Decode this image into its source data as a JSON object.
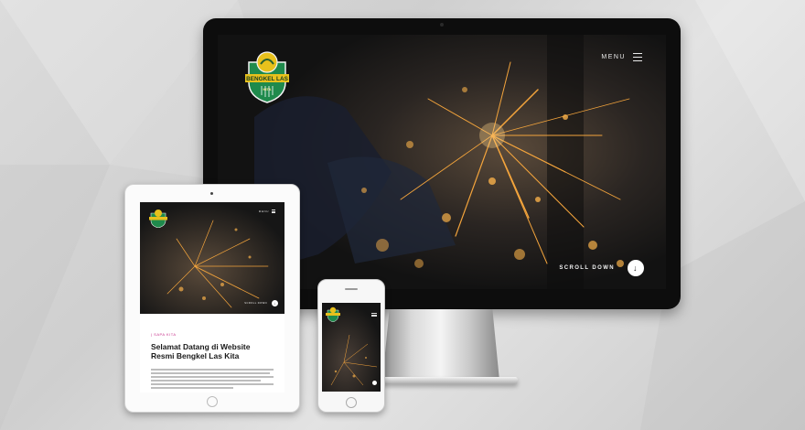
{
  "brand": {
    "logo_text": "BENGKEL LAS",
    "logo_subtext": "KITA",
    "badge_green": "#1f8a4c",
    "badge_yellow": "#e8c11c"
  },
  "desktop": {
    "menu_label": "MENU",
    "scroll_label": "SCROLL DOWN",
    "scroll_icon": "arrow-down-icon"
  },
  "tablet": {
    "menu_label": "MENU",
    "scroll_label": "SCROLL DOWN",
    "kicker": "| SAPA KITA",
    "title_line1": "Selamat Datang di Website",
    "title_line2": "Resmi Bengkel Las Kita"
  },
  "colors": {
    "spark": "#f0a23a",
    "accent_pink": "#c7318b"
  }
}
